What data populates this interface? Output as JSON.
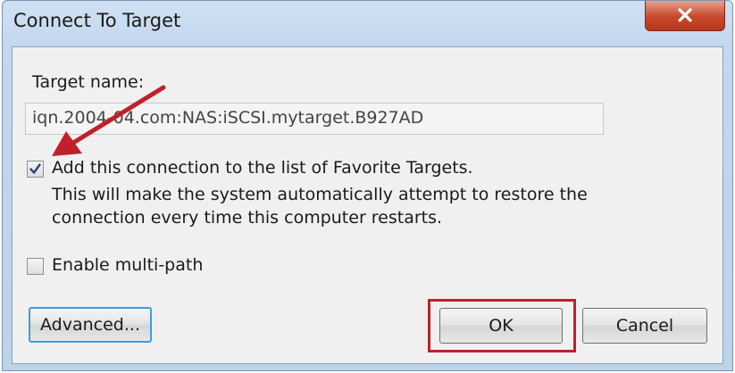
{
  "window": {
    "title": "Connect To Target"
  },
  "target": {
    "label": "Target name:",
    "value": "iqn.2004-04.com:NAS:iSCSI.mytarget.B927AD"
  },
  "favorites": {
    "checked": true,
    "label": "Add this connection to the list of Favorite Targets.",
    "description_line1": "This will make the system automatically attempt to restore the",
    "description_line2": "connection every time this computer restarts."
  },
  "multipath": {
    "checked": false,
    "label": "Enable multi-path"
  },
  "buttons": {
    "advanced": "Advanced...",
    "ok": "OK",
    "cancel": "Cancel"
  },
  "annotation_color": "#c0202a",
  "icons": {
    "close": "close-icon",
    "check": "check-icon"
  }
}
